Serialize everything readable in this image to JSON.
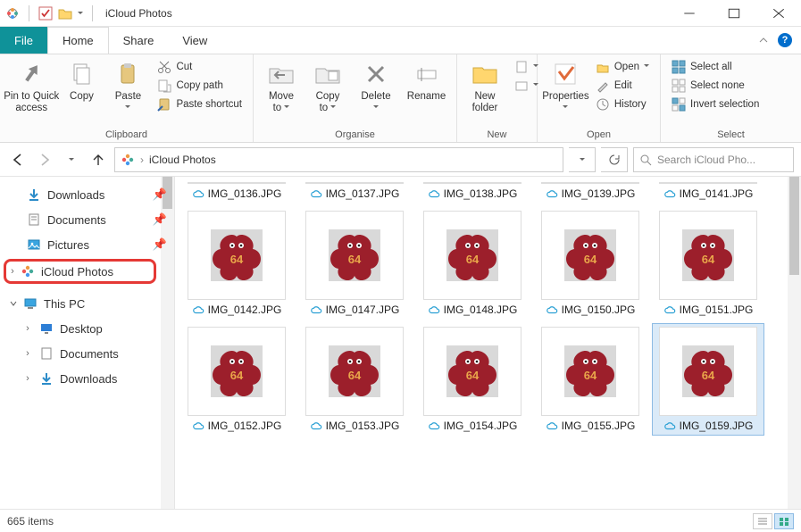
{
  "window": {
    "title": "iCloud Photos"
  },
  "tabs": {
    "file": "File",
    "home": "Home",
    "share": "Share",
    "view": "View"
  },
  "ribbon": {
    "pin_to_quick": "Pin to Quick\naccess",
    "copy": "Copy",
    "paste": "Paste",
    "cut": "Cut",
    "copy_path": "Copy path",
    "paste_shortcut": "Paste shortcut",
    "move_to": "Move\nto",
    "copy_to": "Copy\nto",
    "delete": "Delete",
    "rename": "Rename",
    "new_folder": "New\nfolder",
    "properties": "Properties",
    "open": "Open",
    "edit": "Edit",
    "history": "History",
    "select_all": "Select all",
    "select_none": "Select none",
    "invert_selection": "Invert selection",
    "group_clipboard": "Clipboard",
    "group_organise": "Organise",
    "group_new": "New",
    "group_open": "Open",
    "group_select": "Select"
  },
  "breadcrumb": {
    "current": "iCloud Photos"
  },
  "search": {
    "placeholder": "Search iCloud Pho..."
  },
  "sidebar": {
    "downloads": "Downloads",
    "documents": "Documents",
    "pictures": "Pictures",
    "icloud_photos": "iCloud Photos",
    "this_pc": "This PC",
    "desktop": "Desktop",
    "documents2": "Documents",
    "downloads2": "Downloads"
  },
  "files": [
    {
      "name": "IMG_0136.JPG"
    },
    {
      "name": "IMG_0137.JPG"
    },
    {
      "name": "IMG_0138.JPG"
    },
    {
      "name": "IMG_0139.JPG"
    },
    {
      "name": "IMG_0141.JPG"
    },
    {
      "name": "IMG_0142.JPG"
    },
    {
      "name": "IMG_0147.JPG"
    },
    {
      "name": "IMG_0148.JPG"
    },
    {
      "name": "IMG_0150.JPG"
    },
    {
      "name": "IMG_0151.JPG"
    },
    {
      "name": "IMG_0152.JPG"
    },
    {
      "name": "IMG_0153.JPG"
    },
    {
      "name": "IMG_0154.JPG"
    },
    {
      "name": "IMG_0155.JPG"
    },
    {
      "name": "IMG_0159.JPG"
    }
  ],
  "status": {
    "count": "665 items"
  }
}
